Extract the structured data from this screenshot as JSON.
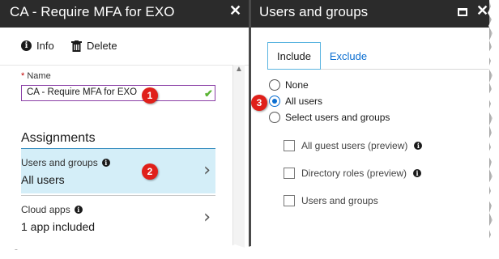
{
  "left_blade": {
    "title": "CA - Require MFA for EXO",
    "toolbar": {
      "info_label": "Info",
      "delete_label": "Delete"
    },
    "name_field": {
      "required_mark": "*",
      "label": "Name",
      "value": "CA - Require MFA for EXO"
    },
    "assignments": {
      "title": "Assignments",
      "items": [
        {
          "title": "Users and groups",
          "value": "All users"
        },
        {
          "title": "Cloud apps",
          "value": "1 app included"
        }
      ]
    }
  },
  "right_blade": {
    "title": "Users and groups",
    "tabs": [
      {
        "label": "Include"
      },
      {
        "label": "Exclude"
      }
    ],
    "radios": [
      {
        "label": "None",
        "checked": false
      },
      {
        "label": "All users",
        "checked": true
      },
      {
        "label": "Select users and groups",
        "checked": false
      }
    ],
    "checkboxes": [
      {
        "label": "All guest users (preview)"
      },
      {
        "label": "Directory roles (preview)"
      },
      {
        "label": "Users and groups"
      }
    ]
  },
  "callouts": [
    "1",
    "2",
    "3"
  ],
  "colors": {
    "header_bg": "#2b2b2b",
    "selected_item_bg": "#d4eef8",
    "accent_blue": "#0a6ed1",
    "callout_red": "#e0201a",
    "input_border": "#8a3fa6",
    "valid_green": "#5bb434"
  },
  "icons": {
    "close": "close-icon",
    "maximize": "maximize-icon",
    "info": "info-icon",
    "delete": "trash-icon",
    "valid": "checkmark-icon",
    "chevron": "chevron-right-icon"
  }
}
